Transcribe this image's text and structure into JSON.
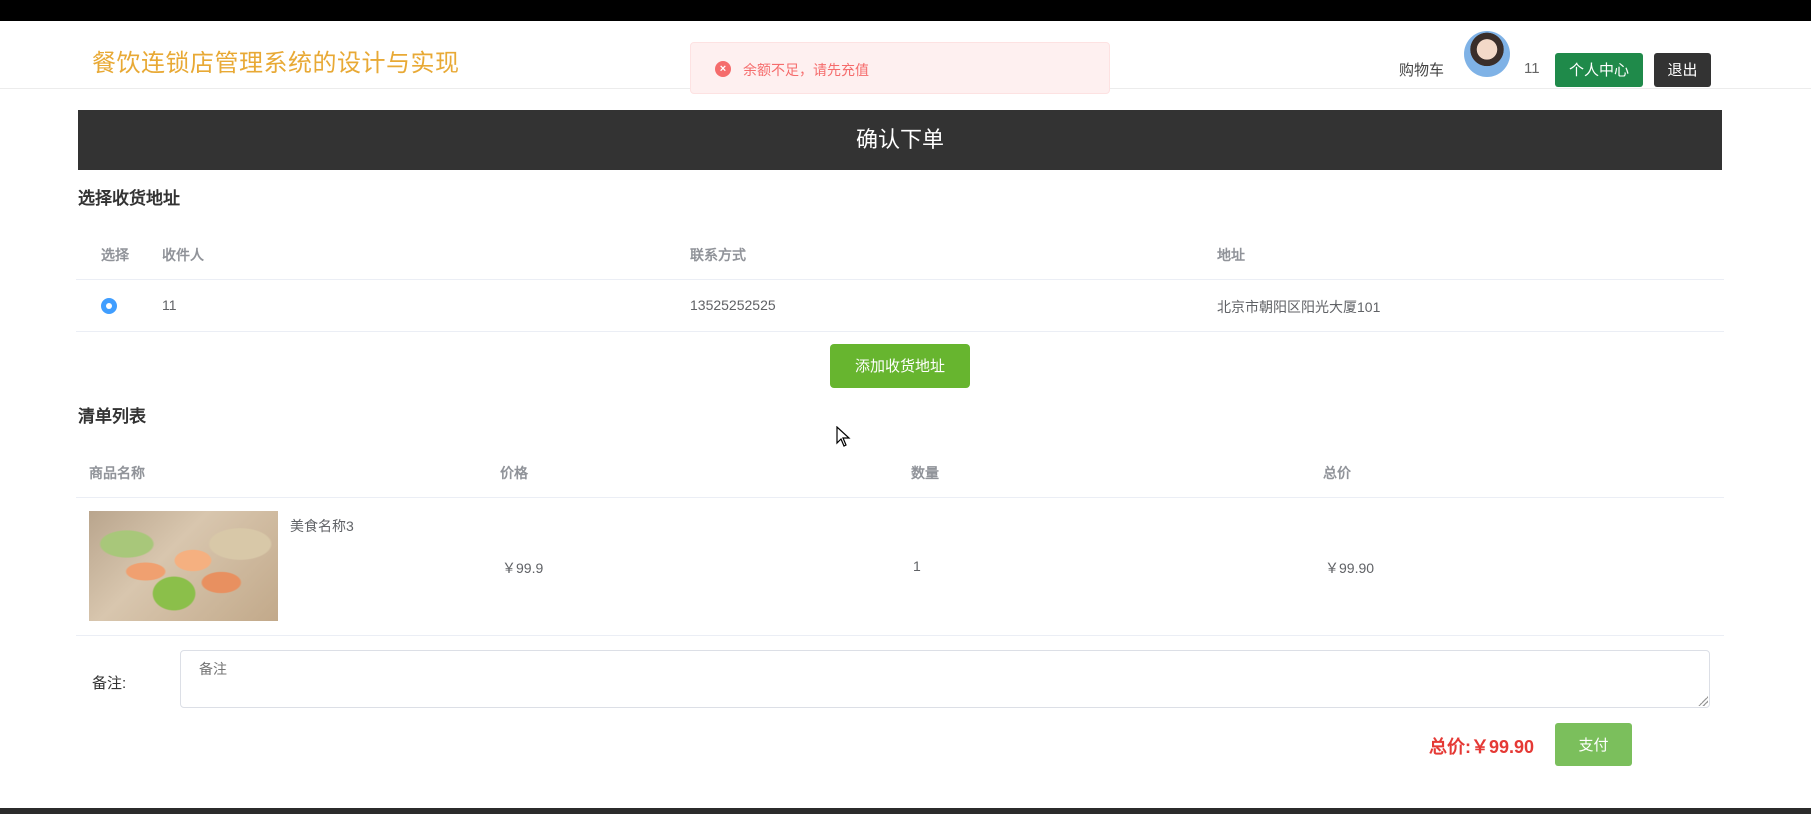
{
  "header": {
    "site_title": "餐饮连锁店管理系统的设计与实现",
    "cart_label": "购物车",
    "user_name": "11",
    "profile_button": "个人中心",
    "logout_button": "退出"
  },
  "toast": {
    "icon": "error-circle-icon",
    "message": "余额不足，请先充值",
    "color": "#f56c6c"
  },
  "order": {
    "title": "确认下单"
  },
  "address_section": {
    "title": "选择收货地址",
    "columns": [
      "选择",
      "收件人",
      "联系方式",
      "地址"
    ],
    "rows": [
      {
        "selected": true,
        "recipient": "11",
        "phone": "13525252525",
        "address": "北京市朝阳区阳光大厦101"
      }
    ],
    "add_button": "添加收货地址"
  },
  "list_section": {
    "title": "清单列表",
    "columns": [
      "商品名称",
      "价格",
      "数量",
      "总价"
    ],
    "rows": [
      {
        "name": "美食名称3",
        "price": "￥99.9",
        "quantity": "1",
        "total": "￥99.90"
      }
    ]
  },
  "remark": {
    "label": "备注:",
    "placeholder": "备注"
  },
  "footer": {
    "total_label": "总价:",
    "total_value": "￥99.90",
    "pay_button": "支付"
  },
  "colors": {
    "brand": "#e8a935",
    "profile_green": "#1f8a4a",
    "add_green": "#67b52f",
    "pay_green": "#7bbf5c",
    "dark_bar": "#333333",
    "price_red": "#e53935",
    "radio_blue": "#409eff"
  }
}
